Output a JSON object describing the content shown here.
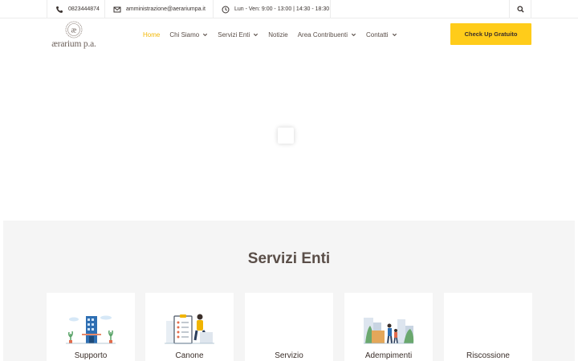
{
  "topbar": {
    "phone": "0823444874",
    "email": "amministrazione@aerariumpa.it",
    "hours": "Lun - Ven: 9:00 - 13:00 | 14:30 - 18:30"
  },
  "header": {
    "logo_text": "ærarium p.a.",
    "logo_mark": "æ",
    "nav": [
      {
        "label": "Home"
      },
      {
        "label": "Chi Siamo"
      },
      {
        "label": "Servizi Enti"
      },
      {
        "label": "Notizie"
      },
      {
        "label": "Area Contribuenti"
      },
      {
        "label": "Contatti"
      }
    ],
    "cta_label": "Check Up Gratuito"
  },
  "services": {
    "title": "Servizi Enti",
    "cards": [
      {
        "label": "Supporto",
        "icon": "building-illustration"
      },
      {
        "label": "Canone",
        "icon": "clipboard-person-illustration"
      },
      {
        "label": "Servizio",
        "icon": "blank"
      },
      {
        "label": "Adempimenti",
        "icon": "city-people-illustration"
      },
      {
        "label": "Riscossione",
        "icon": "blank"
      }
    ]
  },
  "colors": {
    "accent": "#ffcc1a",
    "active_nav": "#f2b705",
    "text": "#5a4e48",
    "section_bg": "#f5f5f5"
  }
}
